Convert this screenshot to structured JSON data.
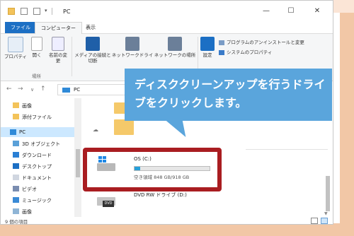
{
  "window": {
    "title": "PC",
    "controls": {
      "minimize": "—",
      "maximize": "☐",
      "close": "✕"
    }
  },
  "ribbon_tabs": [
    "ファイル",
    "コンピューター",
    "表示"
  ],
  "ribbon": {
    "properties": "プロパティ",
    "open": "開く",
    "rename": "名前の変更",
    "access_media": "メディアの接続と切断",
    "map_drive": "ネットワークドライブの割り当て",
    "add_location": "ネットワークの場所の追加",
    "settings": "設定",
    "uninstall": "プログラムのアンインストールと変更",
    "system_props": "システムのプロパティ",
    "group_location": "場所"
  },
  "address": {
    "path": "PC"
  },
  "sidebar": {
    "items": [
      "画像",
      "添付ファイル",
      "PC",
      "3D オブジェクト",
      "ダウンロード",
      "デスクトップ",
      "ドキュメント",
      "ビデオ",
      "ミュージック",
      "画像"
    ]
  },
  "drives": [
    {
      "name": "OS (C:)",
      "free": "空き領域 848 GB/918 GB",
      "used_fraction": 0.076
    },
    {
      "name": "DVD RW ドライブ (D:)",
      "free": "",
      "used_fraction": 0
    }
  ],
  "status": {
    "items": "9 個の項目"
  },
  "callout": {
    "text": "ディスククリーンアップを行うドライブをクリックします。"
  },
  "colors": {
    "accent": "#1c6fc4",
    "callout": "#5aa5dc",
    "highlight": "#a91d21",
    "selection": "#cce8ff"
  }
}
